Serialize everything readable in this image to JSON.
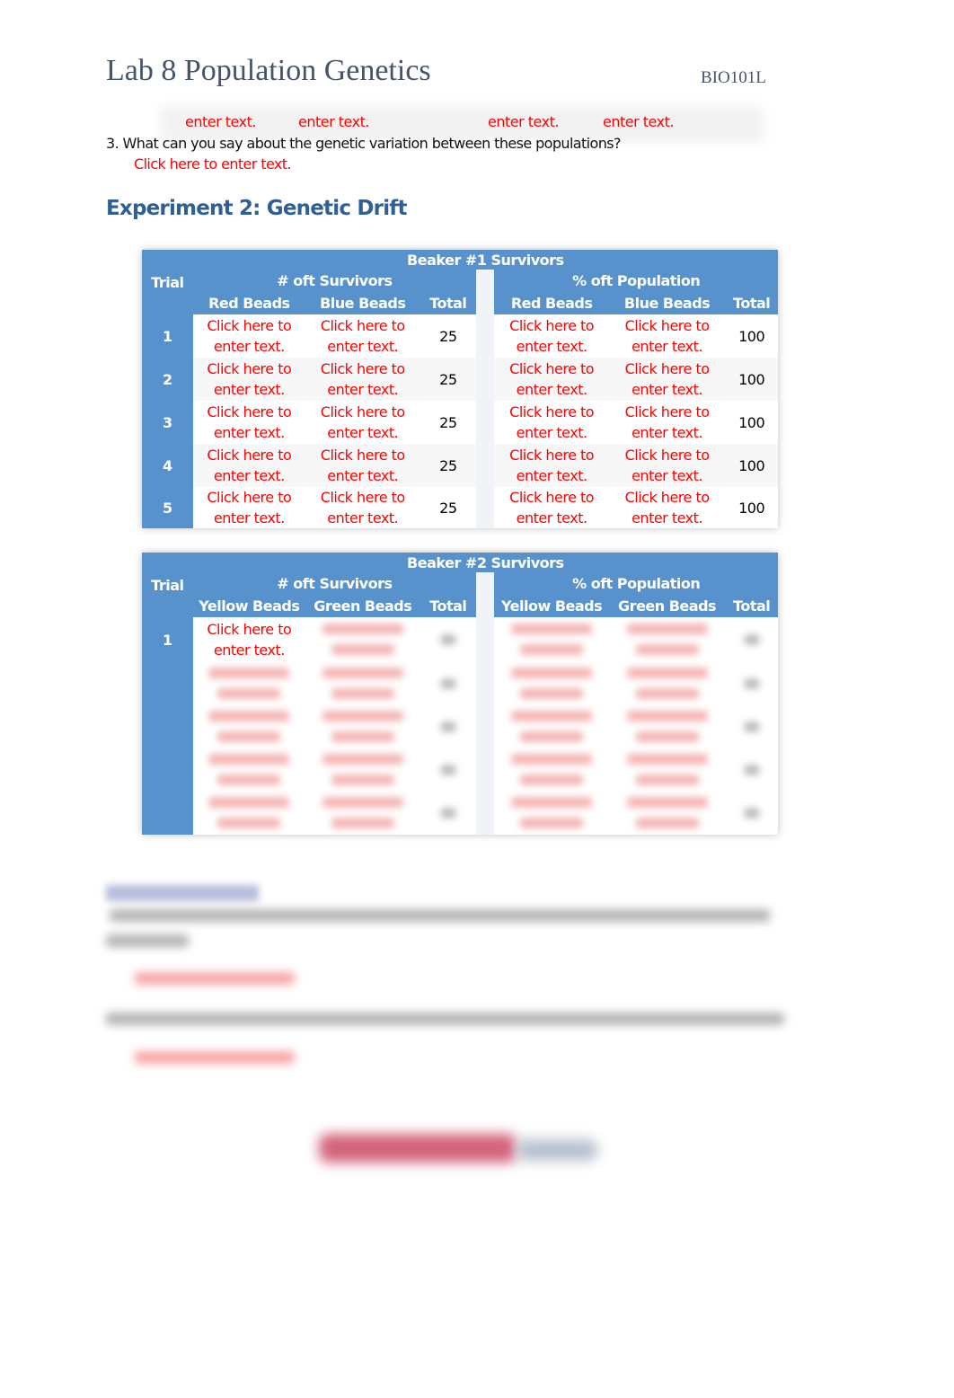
{
  "header": {
    "title": "Lab 8 Population Genetics",
    "course": "BIO101L"
  },
  "previous_table_fragment": {
    "visible_entries": [
      "enter text.",
      "enter text.",
      "enter text.",
      "enter text."
    ]
  },
  "question3": {
    "text": "3. What can you say about the genetic variation between these populations?",
    "answer_placeholder": "Click here to enter text."
  },
  "section": {
    "heading": "Experiment 2: Genetic Drift"
  },
  "beaker1": {
    "title": "Beaker #1 Survivors",
    "trial_header": "Trial",
    "group1": "# oft Survivors",
    "group2": "% oft Population",
    "cols": [
      "Red Beads",
      "Blue Beads",
      "Total",
      "Red Beads",
      "Blue Beads",
      "Total"
    ],
    "placeholder_line1": "Click here to",
    "placeholder_line2": "enter text.",
    "rows": [
      {
        "trial": "1",
        "count_total": "25",
        "pct_total": "100"
      },
      {
        "trial": "2",
        "count_total": "25",
        "pct_total": "100"
      },
      {
        "trial": "3",
        "count_total": "25",
        "pct_total": "100"
      },
      {
        "trial": "4",
        "count_total": "25",
        "pct_total": "100"
      },
      {
        "trial": "5",
        "count_total": "25",
        "pct_total": "100"
      }
    ]
  },
  "beaker2": {
    "title": "Beaker #2 Survivors",
    "trial_header": "Trial",
    "group1": "# oft Survivors",
    "group2": "% oft Population",
    "cols": [
      "Yellow Beads",
      "Green Beads",
      "Total",
      "Yellow Beads",
      "Green Beads",
      "Total"
    ],
    "placeholder_line1": "Click here to",
    "placeholder_line2": "enter text.",
    "rows": [
      {
        "trial": "1"
      }
    ]
  }
}
